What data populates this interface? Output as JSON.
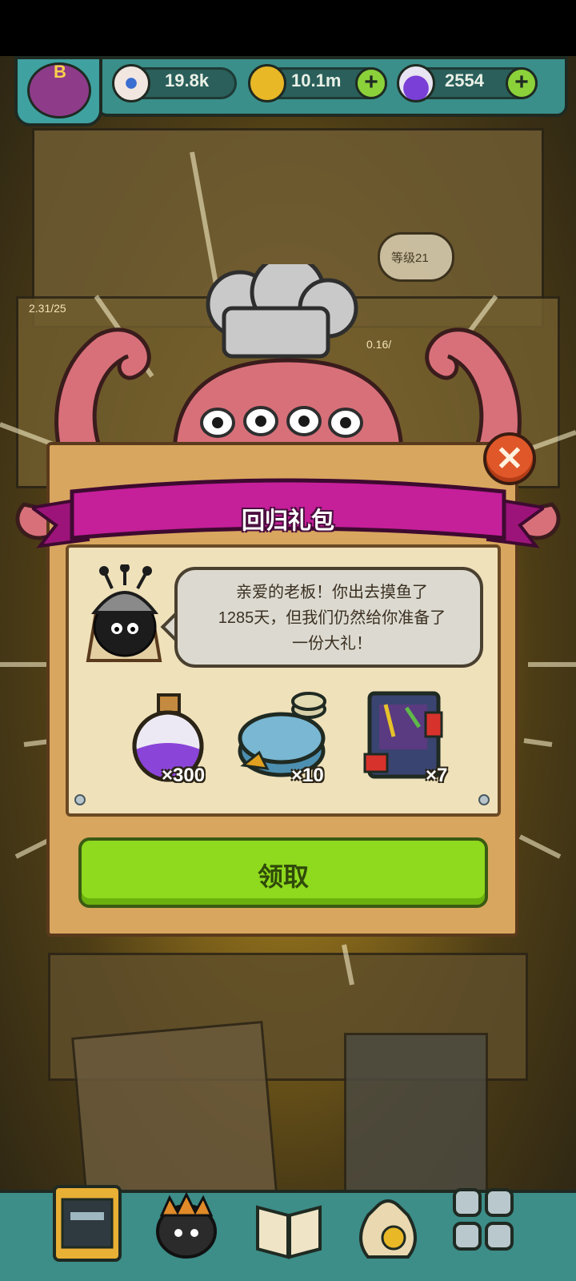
{
  "resources": {
    "eyeball": "19.8k",
    "coins": "10.1m",
    "potion": "2554",
    "plus": "+"
  },
  "avatar": {
    "letter": "B"
  },
  "background": {
    "floor_counter_left": "2.31/25",
    "floor_counter_mid": "0.16/",
    "level_label": "等级21"
  },
  "dialog": {
    "title": "回归礼包",
    "close": "✕",
    "message_lines": [
      "亲爱的老板！你出去摸鱼了",
      "1285天，但我们仍然给你准备了",
      "一份大礼！"
    ],
    "rewards": [
      {
        "icon": "purple-potion-icon",
        "count": "×300"
      },
      {
        "icon": "blue-coin-crate-icon",
        "count": "×10"
      },
      {
        "icon": "gift-card-icon",
        "count": "×7"
      }
    ],
    "claim_button": "领取"
  },
  "colors": {
    "ribbon": "#c51f9a",
    "claim": "#8fd91e",
    "close": "#e0572a",
    "topbar": "#3a8f8a"
  }
}
